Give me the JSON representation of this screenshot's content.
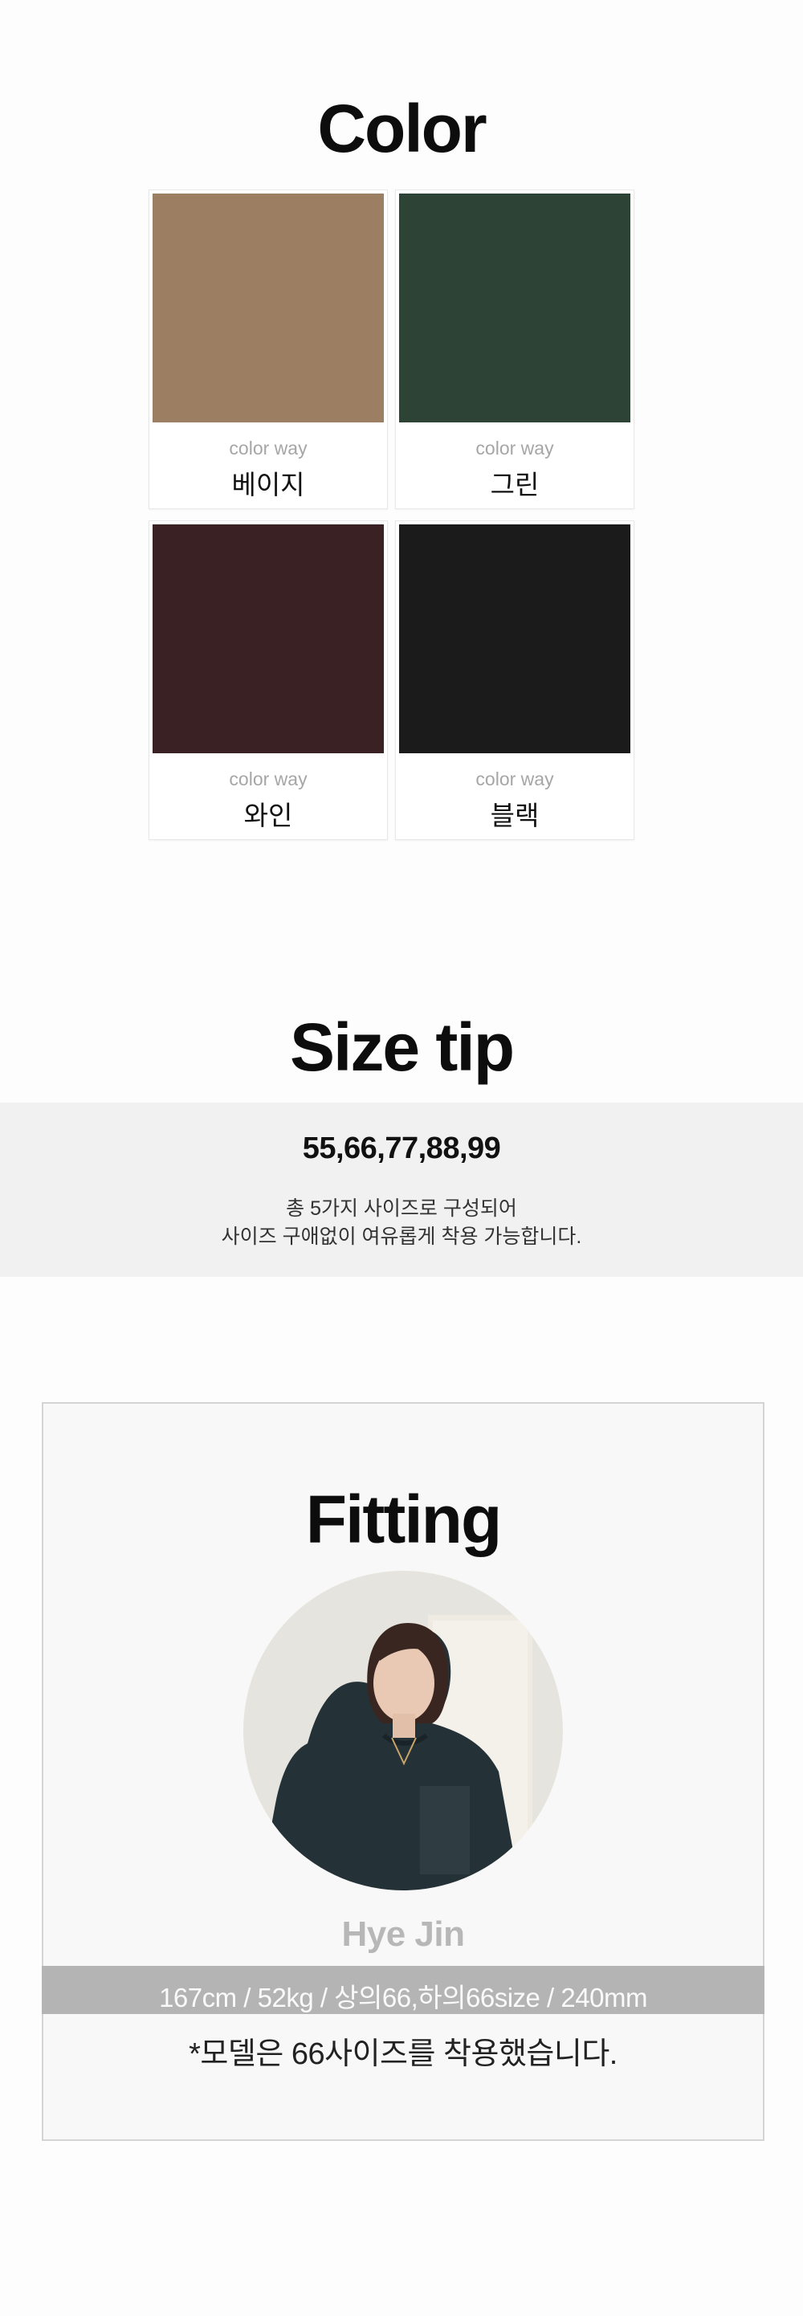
{
  "color_section": {
    "title": "Color",
    "swatches": [
      {
        "sub": "color way",
        "name": "베이지",
        "color": "#9c7f62"
      },
      {
        "sub": "color way",
        "name": "그린",
        "color": "#2d4335"
      },
      {
        "sub": "color way",
        "name": "와인",
        "color": "#3a2224"
      },
      {
        "sub": "color way",
        "name": "블랙",
        "color": "#1b1b1b"
      }
    ]
  },
  "size_section": {
    "title": "Size tip",
    "sizes": "55,66,77,88,99",
    "desc_line1": "총 5가지 사이즈로 구성되어",
    "desc_line2": "사이즈 구애없이 여유롭게 착용 가능합니다."
  },
  "fitting_section": {
    "title": "Fitting",
    "model_name": "Hye Jin",
    "model_stats": "167cm / 52kg / 상의66,하의66size / 240mm",
    "note": "*모델은 66사이즈를 착용했습니다."
  }
}
